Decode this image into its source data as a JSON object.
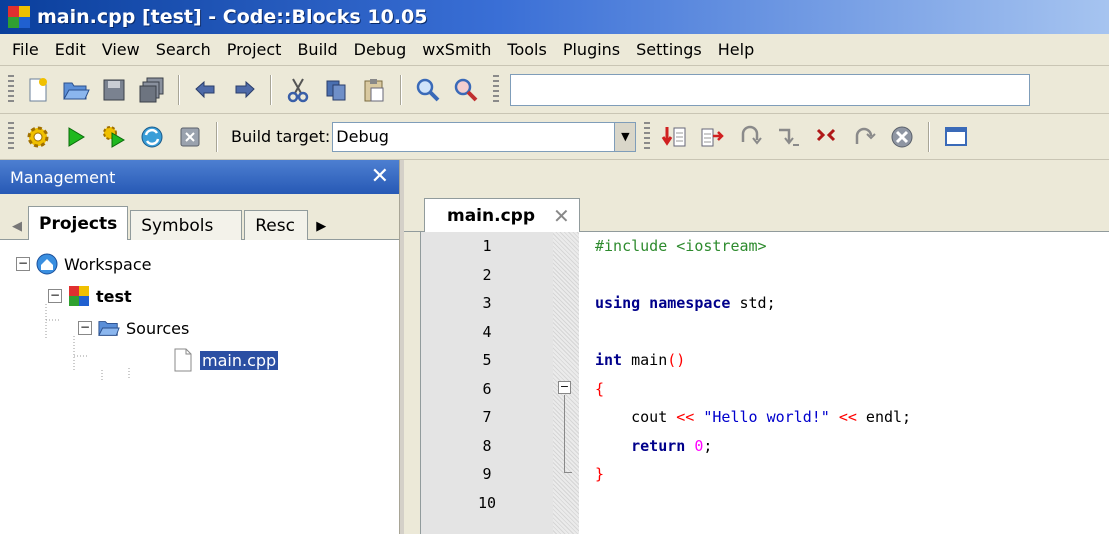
{
  "window": {
    "title": "main.cpp [test] - Code::Blocks 10.05"
  },
  "menu": [
    "File",
    "Edit",
    "View",
    "Search",
    "Project",
    "Build",
    "Debug",
    "wxSmith",
    "Tools",
    "Plugins",
    "Settings",
    "Help"
  ],
  "toolbar2": {
    "build_target_label": "Build target:",
    "build_target_value": "Debug"
  },
  "management": {
    "title": "Management",
    "tabs": [
      "Projects",
      "Symbols",
      "Resc"
    ],
    "tree": {
      "workspace": "Workspace",
      "project": "test",
      "folder": "Sources",
      "file": "main.cpp"
    }
  },
  "editor": {
    "tab_label": "main.cpp",
    "line_numbers": [
      "1",
      "2",
      "3",
      "4",
      "5",
      "6",
      "7",
      "8",
      "9",
      "10"
    ],
    "lines": [
      [
        {
          "t": "#include <iostream>",
          "c": "#2e8b2e"
        }
      ],
      [],
      [
        {
          "t": "using namespace",
          "c": "#00008b",
          "b": true
        },
        {
          "t": " std",
          "c": "#000"
        },
        {
          "t": ";",
          "c": "#000"
        }
      ],
      [],
      [
        {
          "t": "int",
          "c": "#00008b",
          "b": true
        },
        {
          "t": " main",
          "c": "#000"
        },
        {
          "t": "()",
          "c": "#ff0000"
        }
      ],
      [
        {
          "t": "{",
          "c": "#ff0000"
        }
      ],
      [
        {
          "t": "    cout ",
          "c": "#000"
        },
        {
          "t": "<<",
          "c": "#ff0000"
        },
        {
          "t": " ",
          "c": "#000"
        },
        {
          "t": "\"Hello world!\"",
          "c": "#0000cd"
        },
        {
          "t": " ",
          "c": "#000"
        },
        {
          "t": "<<",
          "c": "#ff0000"
        },
        {
          "t": " endl;",
          "c": "#000"
        }
      ],
      [
        {
          "t": "    ",
          "c": "#000"
        },
        {
          "t": "return",
          "c": "#00008b",
          "b": true
        },
        {
          "t": " ",
          "c": "#000"
        },
        {
          "t": "0",
          "c": "#ff00ff"
        },
        {
          "t": ";",
          "c": "#000"
        }
      ],
      [
        {
          "t": "}",
          "c": "#ff0000"
        }
      ],
      []
    ]
  },
  "colors": {
    "titlebar": "#0a3f9c",
    "selection": "#2b4fa3",
    "menubar": "#ece9d8"
  }
}
